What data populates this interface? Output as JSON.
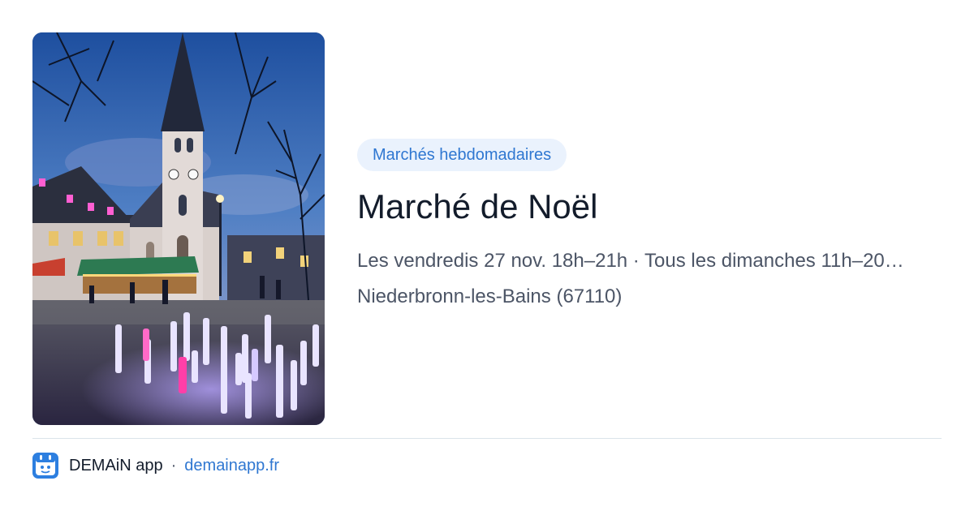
{
  "event": {
    "category": "Marchés hebdomadaires",
    "title": "Marché de Noël",
    "schedule": "Les vendredis 27 nov. 18h–21h · Tous les dimanches 11h–20…",
    "location": "Niederbronn-les-Bains (67110)"
  },
  "photo": {
    "icon": "christmas-market-church-photo"
  },
  "footer": {
    "app_name": "DEMAiN app",
    "separator": "·",
    "site": "demainapp.fr",
    "icon": "demain-app-logo-icon"
  },
  "colors": {
    "accent": "#2f77d1",
    "badge_bg": "#eaf2fd",
    "title": "#131c2b",
    "muted": "#4c5566",
    "divider": "#dbe4ea",
    "app_icon": "#2d7fe0"
  }
}
